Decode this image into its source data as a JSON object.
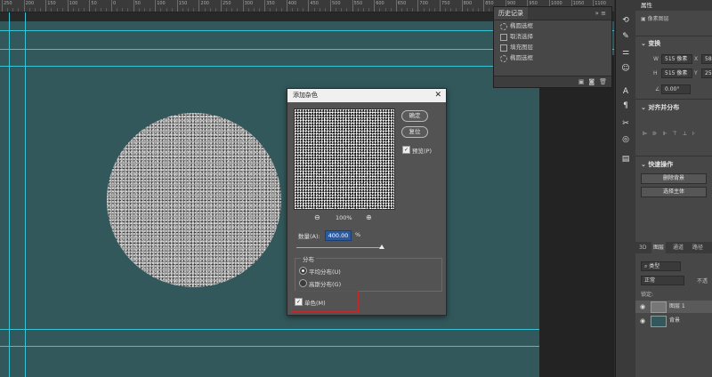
{
  "ruler": {
    "ticks": [
      "250",
      "200",
      "150",
      "100",
      "50",
      "0",
      "50",
      "100",
      "150",
      "200",
      "250",
      "300",
      "350",
      "400",
      "450",
      "500",
      "550",
      "600",
      "650",
      "700",
      "750",
      "800",
      "850",
      "900",
      "950",
      "1000",
      "1050",
      "1100",
      "1150"
    ]
  },
  "history": {
    "title": "历史记录",
    "tools": "»  ≡",
    "items": [
      {
        "icon": "ellipse-select-icon",
        "label": "椭圆选框"
      },
      {
        "icon": "document-icon",
        "label": "取消选择"
      },
      {
        "icon": "document-icon",
        "label": "填充图层"
      },
      {
        "icon": "ellipse-select-icon",
        "label": "椭圆选框"
      }
    ],
    "footer_icons": [
      "new-snapshot-icon",
      "camera-icon",
      "trash-icon"
    ]
  },
  "properties": {
    "tab": "属性",
    "doc_label": "像素图层",
    "transform": "变换",
    "w_label": "W",
    "w_value": "515 像素",
    "h_label": "H",
    "h_value": "515 像素",
    "x_label": "X",
    "x_value": "58",
    "y_label": "Y",
    "y_value": "25",
    "angle_value": "0.00°",
    "align_title": "对齐并分布",
    "quick_title": "快速操作",
    "btn_remove_bg": "删除背景",
    "btn_select_subject": "选择主体"
  },
  "layers": {
    "tabs": [
      "3D",
      "图层",
      "通道",
      "路径"
    ],
    "search": "类型",
    "blend": "正常",
    "opacity_label": "不透",
    "lock_label": "锁定:",
    "items": [
      {
        "name": "图层 1"
      },
      {
        "name": "背景"
      }
    ]
  },
  "dialog": {
    "title": "添加杂色",
    "ok": "确定",
    "reset": "复位",
    "preview_label": "预览(P)",
    "preview_checked": true,
    "zoom": "100%",
    "amount_label": "数量(A):",
    "amount_value": "400.00",
    "amount_unit": "%",
    "amount_level": 1.0,
    "distribution_title": "分布",
    "uniform": "平均分布(U)",
    "gaussian": "高斯分布(G)",
    "selected_distribution": "uniform",
    "mono": "单色(M)",
    "mono_checked": true
  },
  "colors": {
    "canvas": "#32585c",
    "guide": "#39c3d7",
    "highlight": "#c62828"
  }
}
